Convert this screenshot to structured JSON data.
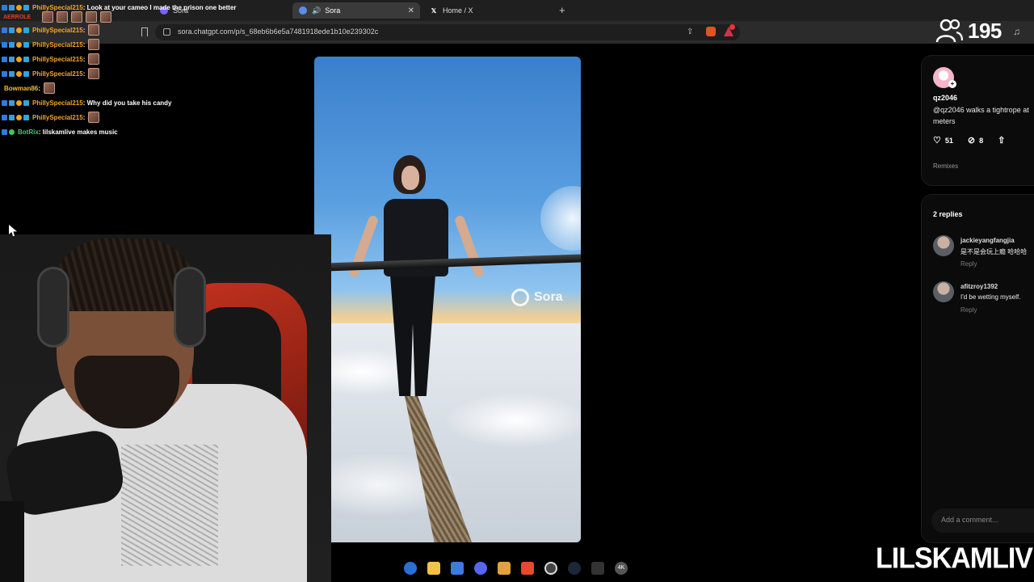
{
  "browser": {
    "tabs": [
      {
        "label": "Sora",
        "active": false
      },
      {
        "label": "Sora",
        "active": true,
        "audio": true
      },
      {
        "label": "Home / X",
        "active": false
      }
    ],
    "url": "sora.chatgpt.com/p/s_68eb6b6e5a7481918ede1b10e239302c"
  },
  "overlay": {
    "viewer_count": "195",
    "brand": "LILSKAMLIVE"
  },
  "chat": [
    {
      "user": "PhillySpecial215",
      "color": "#f5a623",
      "text": ": Look at your cameo I made the prison one better",
      "emote": false
    },
    {
      "user": "AERROLE",
      "color": "#e0412c",
      "text": "",
      "emote": false
    },
    {
      "user": "PhillySpecial215",
      "color": "#f5a623",
      "text": " :",
      "emote": true
    },
    {
      "user": "PhillySpecial215",
      "color": "#f5a623",
      "text": " :",
      "emote": true
    },
    {
      "user": "PhillySpecial215",
      "color": "#f5a623",
      "text": " :",
      "emote": true
    },
    {
      "user": "PhillySpecial215",
      "color": "#f5a623",
      "text": " :",
      "emote": true
    },
    {
      "user": "Bowman86",
      "color": "#f0c030",
      "text": " :",
      "emote": true
    },
    {
      "user": "PhillySpecial215",
      "color": "#f5a623",
      "text": " : Why did you take his candy",
      "emote": false
    },
    {
      "user": "PhillySpecial215",
      "color": "#f5a623",
      "text": " :",
      "emote": true
    },
    {
      "user": "BotRix",
      "color": "#3fd06a",
      "text": " : lilskamlive makes music",
      "emote": false
    }
  ],
  "video": {
    "watermark": "Sora"
  },
  "post": {
    "author": "qz2046",
    "description": "@qz2046 walks a tightrope at meters",
    "likes": "51",
    "remixes_count": "8",
    "remixes_label": "Remixes"
  },
  "replies": {
    "title": "2 replies",
    "items": [
      {
        "user": "jackieyangfangjia",
        "text": "是不是会玩上瘾 哈哈哈",
        "reply": "Reply"
      },
      {
        "user": "afitzroy1392",
        "text": "I'd be wetting myself.",
        "reply": "Reply"
      }
    ],
    "input_placeholder": "Add a comment..."
  },
  "taskbar": {
    "quality_label": "4K"
  }
}
